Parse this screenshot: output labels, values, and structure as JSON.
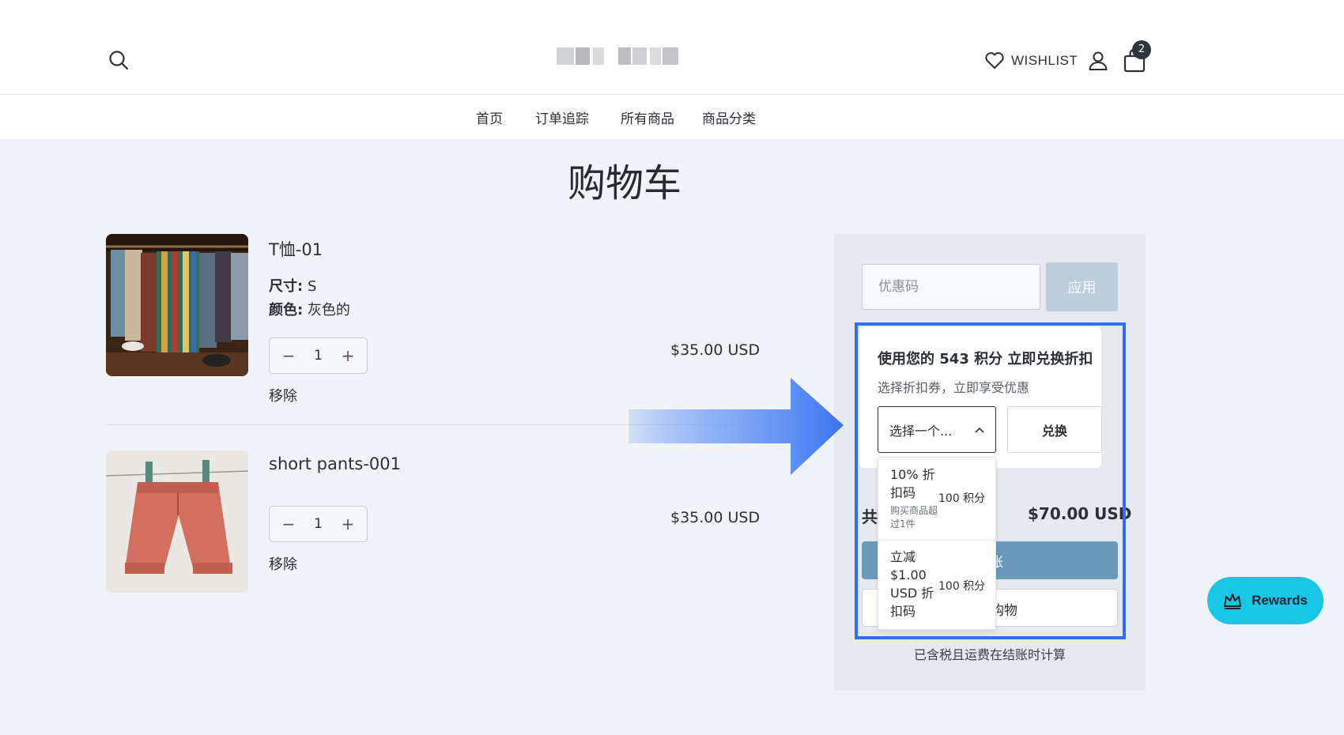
{
  "header": {
    "wishlist_label": "WISHLIST",
    "cart_count": "2"
  },
  "nav": {
    "items": [
      "首页",
      "订单追踪",
      "所有商品",
      "商品分类"
    ]
  },
  "page": {
    "title": "购物车"
  },
  "cart": {
    "items": [
      {
        "name": "T恤-01",
        "options": [
          {
            "label": "尺寸:",
            "value": "S"
          },
          {
            "label": "颜色:",
            "value": "灰色的"
          }
        ],
        "quantity": "1",
        "remove_label": "移除",
        "price": "$35.00 USD"
      },
      {
        "name": "short pants-001",
        "quantity": "1",
        "remove_label": "移除",
        "price": "$35.00 USD"
      }
    ]
  },
  "summary": {
    "coupon_placeholder": "优惠码",
    "apply_label": "应用",
    "total_label": "共",
    "total_value": "$70.00 USD",
    "checkout_label": "账",
    "continue_label": "购物",
    "tax_note": "已含税且运费在结账时计算"
  },
  "rewards_widget": {
    "title": "使用您的 543 积分 立即兑换折扣",
    "subtitle": "选择折扣券，立即享受优惠",
    "select_value": "选择一个...",
    "redeem_label": "兑换",
    "options": [
      {
        "name": "10% 折扣码",
        "points": "100 积分",
        "description": "购买商品超过1件"
      },
      {
        "name": "立减 $1.00 USD 折扣码",
        "points": "100 积分"
      }
    ]
  },
  "rewards_button": {
    "label": "Rewards"
  },
  "colors": {
    "highlight": "#2f6ff2",
    "rewards_fab": "#18c6e6",
    "checkout": "#6a9abb",
    "apply": "#bccddc"
  }
}
